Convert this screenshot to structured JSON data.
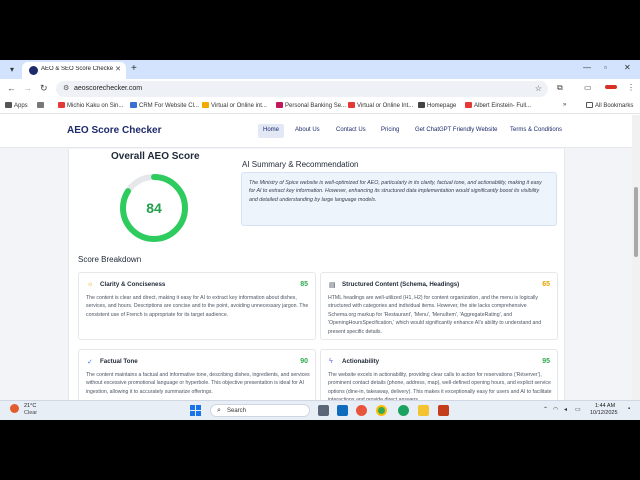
{
  "browser": {
    "tab_title": "AEO & SEO Score Checker | Op",
    "url": "aeoscorechecker.com",
    "bookmarks": [
      {
        "label": "Apps",
        "color": "#555555"
      },
      {
        "label": "Michio Kaku on Sin...",
        "color": "#e53935"
      },
      {
        "label": "CRM For Website Cl...",
        "color": "#3b6fd6"
      },
      {
        "label": "Virtual or Online int...",
        "color": "#f2a900"
      },
      {
        "label": "Personal Banking Se...",
        "color": "#c2185b"
      },
      {
        "label": "Virtual or Online Int...",
        "color": "#e53935"
      },
      {
        "label": "Homepage",
        "color": "#444444"
      },
      {
        "label": "Albert Einstein- Full...",
        "color": "#e53935"
      }
    ],
    "all_bookmarks": "All Bookmarks"
  },
  "site": {
    "logo": "AEO Score Checker",
    "nav": [
      "Home",
      "About Us",
      "Contact Us",
      "Pricing",
      "Get ChatGPT Friendly Website",
      "Terms & Conditions"
    ],
    "active_nav": "Home"
  },
  "score": {
    "title": "Overall AEO Score",
    "value": "84",
    "fraction": 0.84,
    "color": "#2ecc5f"
  },
  "ai_summary": {
    "title": "AI Summary & Recommendation",
    "text": "The Ministry of Spice website is well-optimized for AEO, particularly in its clarity, factual tone, and actionability, making it easy for AI to extract key information. However, enhancing its structured data implementation would significantly boost its visibility and detailed understanding by large language models."
  },
  "breakdown": {
    "title": "Score Breakdown",
    "items": [
      {
        "icon": "lightbulb-icon",
        "glyph": "☼",
        "title": "Clarity & Conciseness",
        "score": "85",
        "score_color": "#2ea84f",
        "text": "The content is clear and direct, making it easy for AI to extract key information about dishes, services, and hours. Descriptions are concise and to the point, avoiding unnecessary jargon. The consistent use of French is appropriate for its target audience."
      },
      {
        "icon": "document-icon",
        "glyph": "▤",
        "title": "Structured Content (Schema, Headings)",
        "score": "65",
        "score_color": "#e2a300",
        "text": "HTML headings are well-utilized (H1, H2) for content organization, and the menu is logically structured with categories and individual items. However, the site lacks comprehensive Schema.org markup for 'Restaurant', 'Menu', 'MenuItem', 'AggregateRating', and 'OpeningHoursSpecification,' which would significantly enhance AI's ability to understand and present specific details."
      },
      {
        "icon": "check-circle-icon",
        "glyph": "✓",
        "title": "Factual Tone",
        "score": "90",
        "score_color": "#2ea84f",
        "text": "The content maintains a factual and informative tone, describing dishes, ingredients, and services without excessive promotional language or hyperbole. This objective presentation is ideal for AI ingestion, allowing it to accurately summarize offerings."
      },
      {
        "icon": "lightning-icon",
        "glyph": "ϟ",
        "title": "Actionability",
        "score": "95",
        "score_color": "#2ea84f",
        "text": "The website excels in actionability, providing clear calls to action for reservations ('Réserver'), prominent contact details (phone, address, map), well-defined opening hours, and explicit service options (dine-in, takeaway, delivery). This makes it exceptionally easy for users and AI to facilitate interactions and provide direct answers."
      }
    ]
  },
  "taskbar": {
    "temp": "21°C",
    "condition": "Clear",
    "search": "Search",
    "time": "1:44 AM",
    "date": "10/12/2025"
  }
}
